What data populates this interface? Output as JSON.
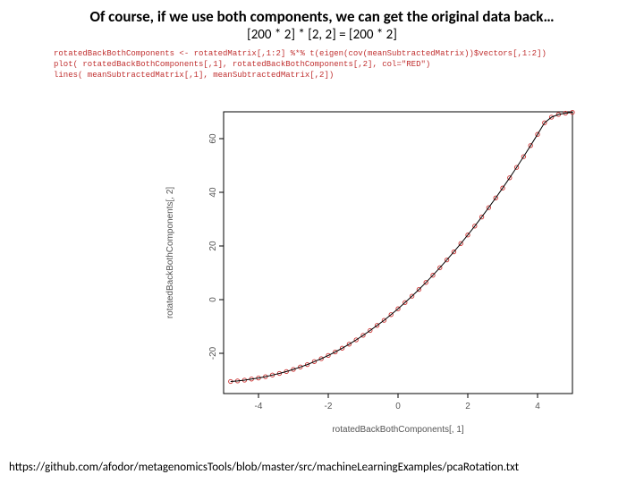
{
  "title": "Of course, if we use both components, we can get the original data back…",
  "subtitle": "[200 * 2] * [2, 2] = [200 * 2]",
  "code": {
    "line1": "rotatedBackBothComponents <- rotatedMatrix[,1:2] %*% t(eigen(cov(meanSubtractedMatrix))$vectors[,1:2])",
    "line2": "plot( rotatedBackBothComponents[,1], rotatedBackBothComponents[,2], col=\"RED\")",
    "line3": "lines( meanSubtractedMatrix[,1], meanSubtractedMatrix[,2])"
  },
  "footer_url": "https://github.com/afodor/metagenomicsTools/blob/master/src/machineLearningExamples/pcaRotation.txt",
  "chart_data": {
    "type": "scatter",
    "title": "",
    "xlabel": "rotatedBackBothComponents[, 1]",
    "ylabel": "rotatedBackBothComponents[, 2]",
    "xlim": [
      -5,
      5
    ],
    "ylim": [
      -35,
      70
    ],
    "x_ticks": [
      -4,
      -2,
      0,
      2,
      4
    ],
    "y_ticks": [
      -20,
      0,
      20,
      40,
      60
    ],
    "series": [
      {
        "name": "reconstructed-points",
        "style": "points",
        "color": "#cc3333",
        "x": [
          -4.8,
          -4.6,
          -4.4,
          -4.2,
          -4.0,
          -3.8,
          -3.6,
          -3.4,
          -3.2,
          -3.0,
          -2.8,
          -2.6,
          -2.4,
          -2.2,
          -2.0,
          -1.8,
          -1.6,
          -1.4,
          -1.2,
          -1.0,
          -0.8,
          -0.6,
          -0.4,
          -0.2,
          0.0,
          0.2,
          0.4,
          0.6,
          0.8,
          1.0,
          1.2,
          1.4,
          1.6,
          1.8,
          2.0,
          2.2,
          2.4,
          2.6,
          2.8,
          3.0,
          3.2,
          3.4,
          3.6,
          3.8,
          4.0,
          4.2,
          4.4,
          4.6,
          4.8,
          5.0
        ],
        "y": [
          -30.5,
          -30.3,
          -30.0,
          -29.6,
          -29.2,
          -28.7,
          -28.1,
          -27.5,
          -26.8,
          -26.0,
          -25.1,
          -24.2,
          -23.1,
          -22.0,
          -20.8,
          -19.5,
          -18.1,
          -16.6,
          -15.0,
          -13.3,
          -11.5,
          -9.6,
          -7.7,
          -5.6,
          -3.4,
          -1.1,
          1.3,
          3.8,
          6.4,
          9.1,
          11.9,
          14.8,
          17.8,
          20.9,
          24.1,
          27.4,
          30.8,
          34.3,
          37.9,
          41.6,
          45.4,
          49.3,
          53.3,
          57.4,
          61.6,
          65.9,
          68.0,
          69.0,
          69.5,
          69.8
        ]
      },
      {
        "name": "original-line",
        "style": "line",
        "color": "#000000",
        "x": [
          -4.8,
          -4.6,
          -4.4,
          -4.2,
          -4.0,
          -3.8,
          -3.6,
          -3.4,
          -3.2,
          -3.0,
          -2.8,
          -2.6,
          -2.4,
          -2.2,
          -2.0,
          -1.8,
          -1.6,
          -1.4,
          -1.2,
          -1.0,
          -0.8,
          -0.6,
          -0.4,
          -0.2,
          0.0,
          0.2,
          0.4,
          0.6,
          0.8,
          1.0,
          1.2,
          1.4,
          1.6,
          1.8,
          2.0,
          2.2,
          2.4,
          2.6,
          2.8,
          3.0,
          3.2,
          3.4,
          3.6,
          3.8,
          4.0,
          4.2,
          4.4,
          4.6,
          4.8,
          5.0
        ],
        "y": [
          -30.5,
          -30.3,
          -30.0,
          -29.6,
          -29.2,
          -28.7,
          -28.1,
          -27.5,
          -26.8,
          -26.0,
          -25.1,
          -24.2,
          -23.1,
          -22.0,
          -20.8,
          -19.5,
          -18.1,
          -16.6,
          -15.0,
          -13.3,
          -11.5,
          -9.6,
          -7.7,
          -5.6,
          -3.4,
          -1.1,
          1.3,
          3.8,
          6.4,
          9.1,
          11.9,
          14.8,
          17.8,
          20.9,
          24.1,
          27.4,
          30.8,
          34.3,
          37.9,
          41.6,
          45.4,
          49.3,
          53.3,
          57.4,
          61.6,
          65.9,
          68.0,
          69.0,
          69.5,
          69.8
        ]
      }
    ]
  }
}
